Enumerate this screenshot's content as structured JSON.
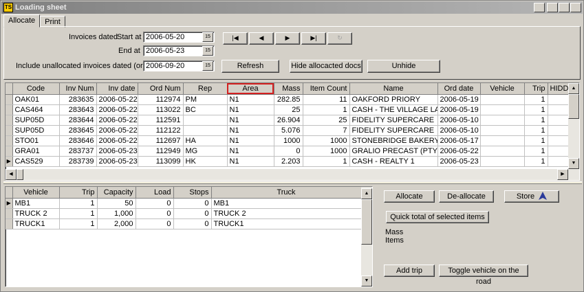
{
  "window": {
    "title": "Loading sheet",
    "app_icon": "TS"
  },
  "tabs": [
    {
      "label": "Allocate"
    },
    {
      "label": "Print"
    }
  ],
  "filter": {
    "invoices_dated_label": "Invoices dated",
    "start_at_label": "Start at",
    "start_at_value": "2006-05-20",
    "end_at_label": "End at",
    "end_at_value": "2006-05-23",
    "unallocated_label": "Include unallocated invoices dated (or later)",
    "unallocated_value": "2006-09-20",
    "calendar_glyph": "15"
  },
  "nav": {
    "first": "|◀",
    "prev": "◀",
    "next": "▶",
    "last": "▶|",
    "refresh_icon": "↻"
  },
  "buttons": {
    "refresh": "Refresh",
    "hide_allocated": "Hide allocacted docs",
    "unhide": "Unhide",
    "allocate": "Allocate",
    "deallocate": "De-allocate",
    "store": "Store",
    "quick_total": "Quick total of selected items",
    "add_trip": "Add trip",
    "toggle_vehicle": "Toggle vehicle on the road"
  },
  "summary": {
    "mass_label": "Mass",
    "items_label": "Items"
  },
  "invoices": {
    "columns": [
      "Code",
      "Inv Num",
      "Inv date",
      "Ord Num",
      "Rep",
      "Area",
      "Mass",
      "Item Count",
      "Name",
      "Ord date",
      "Vehicle",
      "Trip",
      "HIDDEN"
    ],
    "rows": [
      [
        "OAK01",
        "283635",
        "2006-05-22",
        "112974",
        "PM",
        "N1",
        "282.85",
        "11",
        "OAKFORD PRIORY",
        "2006-05-19",
        "",
        "1",
        ""
      ],
      [
        "CAS464",
        "283643",
        "2006-05-22",
        "113022",
        "BC",
        "N1",
        "25",
        "1",
        "CASH - THE VILLAGE LAUND",
        "2006-05-19",
        "",
        "1",
        ""
      ],
      [
        "SUP05D",
        "283644",
        "2006-05-22",
        "112591",
        "",
        "N1",
        "26.904",
        "25",
        "FIDELITY SUPERCARE",
        "2006-05-10",
        "",
        "1",
        ""
      ],
      [
        "SUP05D",
        "283645",
        "2006-05-22",
        "112122",
        "",
        "N1",
        "5.076",
        "7",
        "FIDELITY SUPERCARE",
        "2006-05-10",
        "",
        "1",
        ""
      ],
      [
        "STO01",
        "283646",
        "2006-05-22",
        "112697",
        "HA",
        "N1",
        "1000",
        "1000",
        "STONEBRIDGE BAKERY cc",
        "2006-05-17",
        "",
        "1",
        ""
      ],
      [
        "GRA01",
        "283737",
        "2006-05-23",
        "112949",
        "MG",
        "N1",
        "0",
        "1000",
        "GRALIO PRECAST (PTY) LTD",
        "2006-05-22",
        "",
        "1",
        ""
      ],
      [
        "CAS529",
        "283739",
        "2006-05-23",
        "113099",
        "HK",
        "N1",
        "2.203",
        "1",
        "CASH - REALTY 1",
        "2006-05-23",
        "",
        "1",
        ""
      ]
    ],
    "current_row": 6
  },
  "vehicles": {
    "columns": [
      "Vehicle",
      "Trip",
      "Capacity",
      "Load",
      "Stops",
      "Truck"
    ],
    "rows": [
      [
        "MB1",
        "1",
        "50",
        "0",
        "0",
        "MB1"
      ],
      [
        "TRUCK 2",
        "1",
        "1,000",
        "0",
        "0",
        "TRUCK 2"
      ],
      [
        "TRUCK1",
        "1",
        "2,000",
        "0",
        "0",
        "TRUCK1"
      ]
    ],
    "current_row": 0
  }
}
